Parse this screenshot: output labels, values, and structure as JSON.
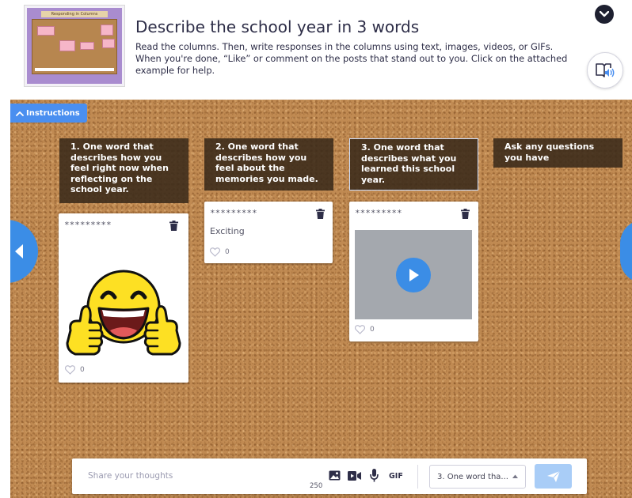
{
  "header": {
    "thumbnail_title": "Responding in Columns",
    "title": "Describe the school year in 3 words",
    "description": "Read the columns. Then, write responses in the columns using text, images, videos, or GIFs. When you're done, “Like” or comment on the posts that stand out to you. Click on the attached example for help.",
    "collapse_icon": "chevron-down-icon",
    "audio_icon": "book-speaker-icon"
  },
  "board": {
    "instructions_label": "Instructions",
    "columns": [
      {
        "header": "1. One word that describes how you feel right now when reflecting on the school year.",
        "posts": [
          {
            "author": "*********",
            "type": "image",
            "image": "smiling-thumbs-up-emoji",
            "likes": "0"
          }
        ]
      },
      {
        "header": "2. One word that describes how you feel about the memories you made.",
        "posts": [
          {
            "author": "*********",
            "type": "text",
            "text": "Exciting",
            "likes": "0"
          }
        ]
      },
      {
        "header": "3. One word that describes what you learned this school year.",
        "selected": true,
        "posts": [
          {
            "author": "*********",
            "type": "video",
            "likes": "0"
          }
        ]
      },
      {
        "header": "Ask any questions you have",
        "posts": []
      }
    ]
  },
  "composer": {
    "placeholder": "Share your thoughts",
    "char_count": "250",
    "gif_label": "GIF",
    "column_select_value": "3. One word tha...",
    "tools": [
      "image-icon",
      "video-icon",
      "microphone-icon",
      "gif"
    ]
  },
  "colors": {
    "accent": "#3b8de6",
    "instructions": "#4a8ff0",
    "send_disabled": "#a9cdf7",
    "column_header_bg": "#3a2a1a"
  }
}
